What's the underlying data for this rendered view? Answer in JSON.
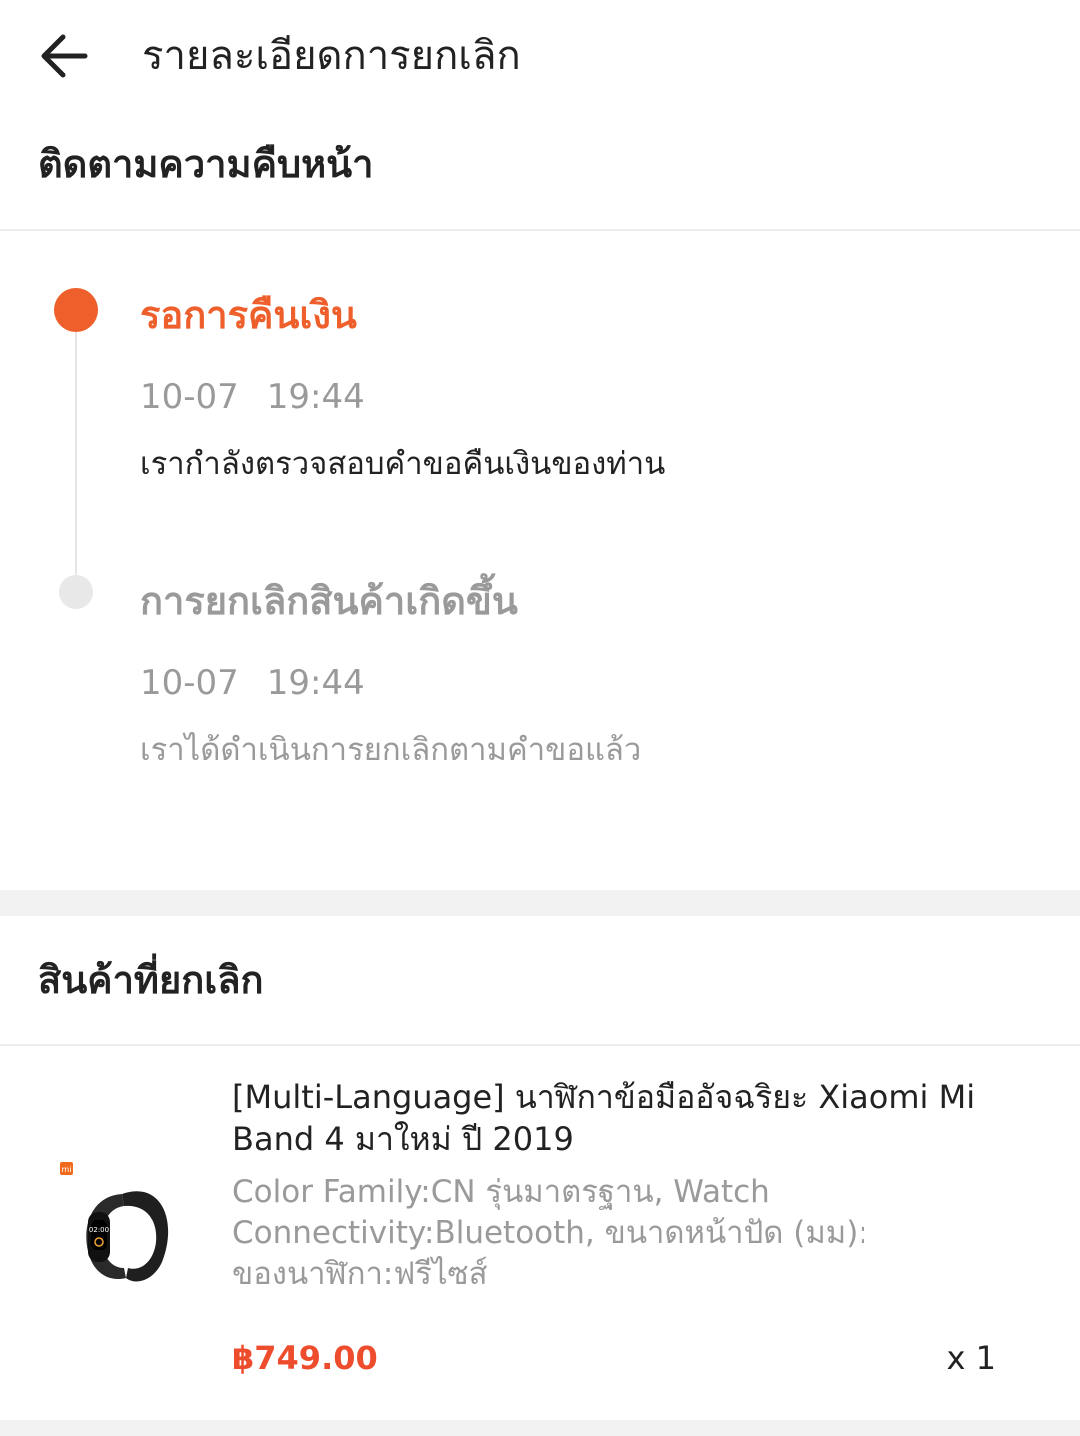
{
  "header": {
    "title": "รายละเอียดการยกเลิก",
    "back_icon": "arrow-left-icon"
  },
  "progress": {
    "title": "ติดตามความคืบหน้า",
    "steps": [
      {
        "title": "รอการคืนเงิน",
        "date": "10-07",
        "time": "19:44",
        "description": "เรากำลังตรวจสอบคำขอคืนเงินของท่าน",
        "active": true
      },
      {
        "title": "การยกเลิกสินค้าเกิดขึ้น",
        "date": "10-07",
        "time": "19:44",
        "description": "เราได้ดำเนินการยกเลิกตามคำขอแล้ว",
        "active": false
      }
    ]
  },
  "cancelled_items": {
    "title": "สินค้าที่ยกเลิก",
    "items": [
      {
        "name": "[Multi-Language] นาฬิกาข้อมืออัจฉริยะ Xiaomi Mi Band 4 มาใหม่ ปี 2019",
        "variant_line1": "Color Family:CN รุ่นมาตรฐาน, Watch",
        "variant_line2": "Connectivity:Bluetooth, ขนาดหน้าปัด (มม):1",
        "variant_line3": "ของนาฬิกา:ฟรีไซส์",
        "price": "฿749.00",
        "quantity": "x 1",
        "brand_mark": "mi",
        "image": "smart-band-icon"
      }
    ]
  },
  "colors": {
    "accent": "#ee5f2b",
    "price": "#ee4d2d",
    "muted": "#9a9a9a"
  }
}
